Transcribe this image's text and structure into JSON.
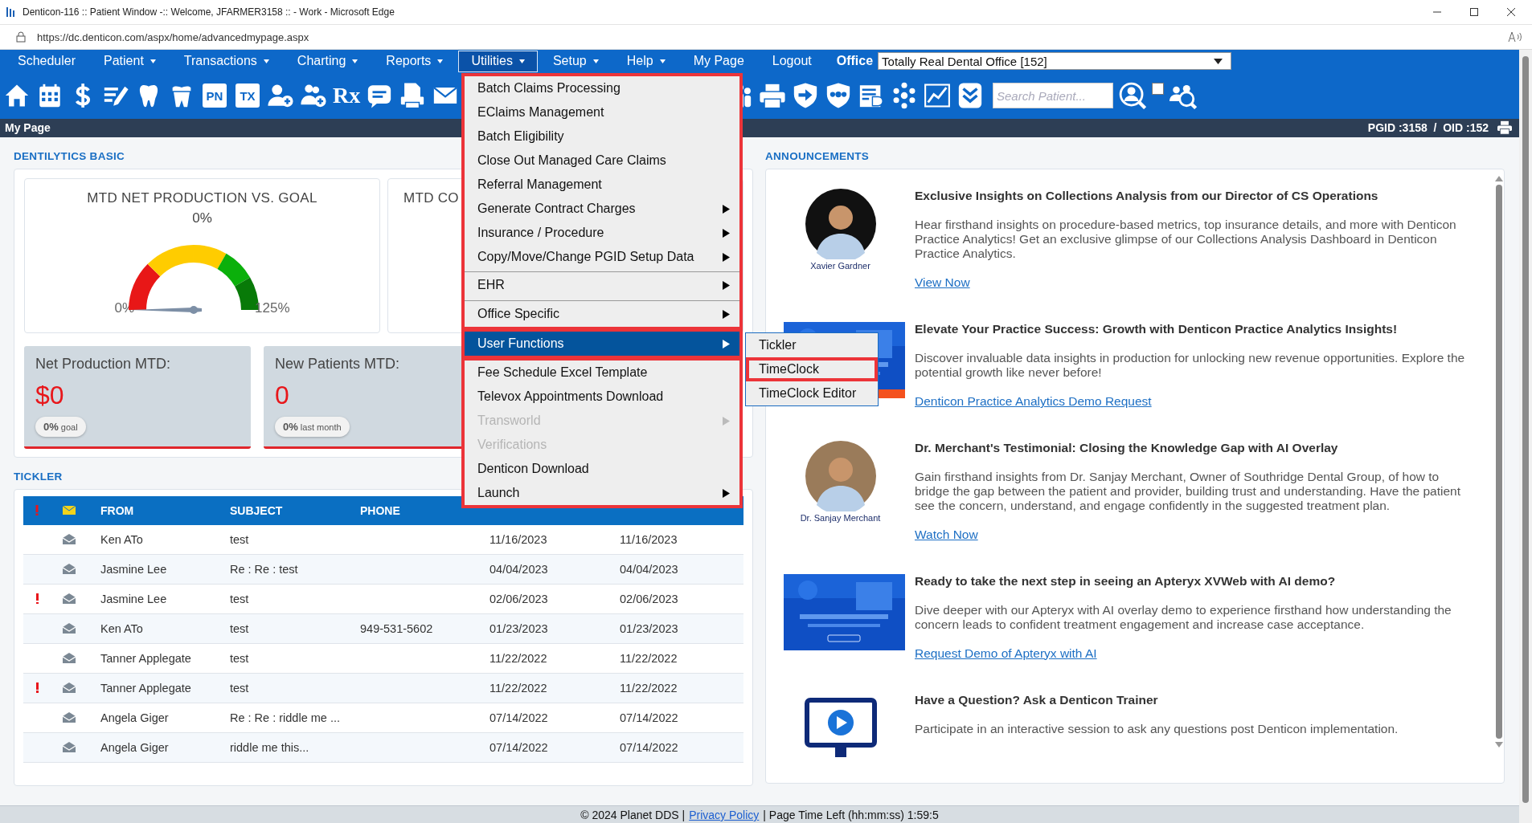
{
  "browser": {
    "title": "Denticon-116 :: Patient Window -:: Welcome, JFARMER3158 :: - Work - Microsoft Edge",
    "url": "https://dc.denticon.com/aspx/home/advancedmypage.aspx"
  },
  "nav": [
    {
      "label": "Scheduler",
      "dropdown": false,
      "selected": false
    },
    {
      "label": "Patient",
      "dropdown": true,
      "selected": false
    },
    {
      "label": "Transactions",
      "dropdown": true,
      "selected": false
    },
    {
      "label": "Charting",
      "dropdown": true,
      "selected": false
    },
    {
      "label": "Reports",
      "dropdown": true,
      "selected": false
    },
    {
      "label": "Utilities",
      "dropdown": true,
      "selected": true
    },
    {
      "label": "Setup",
      "dropdown": true,
      "selected": false
    },
    {
      "label": "Help",
      "dropdown": true,
      "selected": false
    },
    {
      "label": "My Page",
      "dropdown": false,
      "selected": false
    },
    {
      "label": "Logout",
      "dropdown": false,
      "selected": false
    }
  ],
  "office": {
    "label": "Office",
    "value": "Totally Real Dental Office [152]"
  },
  "toolbar_labels": [
    "PN",
    "TX",
    "Rx"
  ],
  "search": {
    "placeholder": "Search Patient..."
  },
  "toolbar_checkbox": {
    "checked": false
  },
  "page_bar": {
    "title": "My Page",
    "ids": "PGID :3158  /  OID :152"
  },
  "dentilytics": {
    "title": "DENTILYTICS BASIC",
    "gauges": [
      {
        "title": "MTD NET PRODUCTION VS. GOAL",
        "reading": "0%",
        "min": "0%",
        "max": "125%"
      },
      {
        "title": "MTD CO"
      }
    ],
    "cards": [
      {
        "title": "Net Production MTD:",
        "value": "$0",
        "pill": "**0%** goal"
      },
      {
        "title": "New Patients MTD:",
        "value": "0",
        "pill": "**0%** last month"
      }
    ]
  },
  "tickler": {
    "title": "TICKLER",
    "columns": [
      "FROM",
      "SUBJECT",
      "PHONE"
    ],
    "rows": [
      {
        "urgent": false,
        "from": "Ken ATo",
        "subject": "test",
        "post_date": "11/16/2023",
        "created_date": "11/16/2023"
      },
      {
        "urgent": false,
        "from": "Jasmine Lee",
        "subject": "Re : Re : test",
        "post_date": "04/04/2023",
        "created_date": "04/04/2023"
      },
      {
        "urgent": true,
        "from": "Jasmine Lee",
        "subject": "test",
        "post_date": "02/06/2023",
        "created_date": "02/06/2023"
      },
      {
        "urgent": false,
        "from": "Ken ATo",
        "subject": "test",
        "phone": "949-531-5602",
        "post_date": "01/23/2023",
        "created_date": "01/23/2023"
      },
      {
        "urgent": false,
        "from": "Tanner Applegate",
        "subject": "test",
        "post_date": "11/22/2022",
        "created_date": "11/22/2022"
      },
      {
        "urgent": true,
        "from": "Tanner Applegate",
        "subject": "test",
        "post_date": "11/22/2022",
        "created_date": "11/22/2022"
      },
      {
        "urgent": false,
        "from": "Angela Giger",
        "subject": "Re : Re : riddle me ...",
        "post_date": "07/14/2022",
        "created_date": "07/14/2022"
      },
      {
        "urgent": false,
        "from": "Angela Giger",
        "subject": "riddle me this...",
        "post_date": "07/14/2022",
        "created_date": "07/14/2022"
      }
    ]
  },
  "menu": {
    "sections": [
      {
        "highlighted": true,
        "items": [
          {
            "label": "Batch Claims Processing",
            "submenu": false,
            "disabled": false,
            "selected": false,
            "separator_before": false
          },
          {
            "label": "EClaims Management",
            "submenu": false,
            "disabled": false,
            "selected": false,
            "separator_before": false
          },
          {
            "label": "Batch Eligibility",
            "submenu": false,
            "disabled": false,
            "selected": false,
            "separator_before": false
          },
          {
            "label": "Close Out Managed Care Claims",
            "submenu": false,
            "disabled": false,
            "selected": false,
            "separator_before": false
          },
          {
            "label": "Referral Management",
            "submenu": false,
            "disabled": false,
            "selected": false,
            "separator_before": false
          },
          {
            "label": "Generate Contract Charges",
            "submenu": true,
            "disabled": false,
            "selected": false,
            "separator_before": false
          },
          {
            "label": "Insurance / Procedure",
            "submenu": true,
            "disabled": false,
            "selected": false,
            "separator_before": false
          },
          {
            "label": "Copy/Move/Change PGID Setup Data",
            "submenu": true,
            "disabled": false,
            "selected": false,
            "separator_before": false
          },
          {
            "label": "EHR",
            "submenu": true,
            "disabled": false,
            "selected": false,
            "separator_before": true
          },
          {
            "label": "Office Specific",
            "submenu": true,
            "disabled": false,
            "selected": false,
            "separator_before": true
          }
        ]
      },
      {
        "highlighted": true,
        "items": [
          {
            "label": "User Functions",
            "submenu": true,
            "disabled": false,
            "selected": true,
            "separator_before": false
          }
        ]
      },
      {
        "highlighted": true,
        "items": [
          {
            "label": "Fee Schedule Excel Template",
            "submenu": false,
            "disabled": false,
            "selected": false,
            "separator_before": false
          },
          {
            "label": "Televox Appointments Download",
            "submenu": false,
            "disabled": false,
            "selected": false,
            "separator_before": false
          },
          {
            "label": "Transworld",
            "submenu": true,
            "disabled": true,
            "selected": false,
            "separator_before": false
          },
          {
            "label": "Verifications",
            "submenu": false,
            "disabled": true,
            "selected": false,
            "separator_before": false
          },
          {
            "label": "Denticon Download",
            "submenu": false,
            "disabled": false,
            "selected": false,
            "separator_before": false
          },
          {
            "label": "Launch",
            "submenu": true,
            "disabled": false,
            "selected": false,
            "separator_before": false
          }
        ]
      }
    ],
    "submenu": [
      {
        "label": "Tickler",
        "highlighted": false
      },
      {
        "label": "TimeClock",
        "highlighted": true
      },
      {
        "label": "TimeClock Editor",
        "highlighted": false
      }
    ]
  },
  "announcements": {
    "title": "ANNOUNCEMENTS",
    "items": [
      {
        "kind": "portrait",
        "caption": "Xavier Gardner",
        "title": "Exclusive Insights on Collections Analysis from our Director of CS Operations",
        "body": "Hear firsthand insights on procedure-based metrics, top insurance details, and more with Denticon Practice Analytics! Get an exclusive glimpse of our Collections Analysis Dashboard in Denticon Practice Analytics.",
        "link": "View Now"
      },
      {
        "kind": "picture",
        "title": "Elevate Your Practice Success: Growth with Denticon Practice Analytics Insights!",
        "body": "Discover invaluable data insights in production for unlocking new revenue opportunities. Explore the potential growth like never before!",
        "link": "Denticon Practice Analytics Demo Request"
      },
      {
        "kind": "portrait",
        "caption": "Dr. Sanjay Merchant",
        "title": "Dr. Merchant's Testimonial: Closing the Knowledge Gap with AI Overlay",
        "body": "Gain firsthand insights from Dr. Sanjay Merchant, Owner of Southridge Dental Group, of how to bridge the gap between the patient and provider, building trust and understanding. Have the patient see the concern, understand, and engage confidently in the suggested treatment plan.",
        "link": "Watch Now"
      },
      {
        "kind": "picture",
        "title": "Ready to take the next step in seeing an Apteryx XVWeb with AI demo?",
        "body": "Dive deeper with our Apteryx with AI overlay demo to experience firsthand how understanding the concern leads to confident treatment engagement and increase case acceptance.",
        "link": "Request Demo of Apteryx with AI"
      },
      {
        "kind": "video",
        "title": "Have a Question? Ask a Denticon Trainer",
        "body": "Participate in an interactive session to ask any questions post Denticon implementation."
      }
    ]
  },
  "footer": {
    "copyright": "© 2024 Planet DDS |",
    "link": "Privacy Policy",
    "time_left": "| Page Time Left (hh:mm:ss) 1:59:5"
  }
}
